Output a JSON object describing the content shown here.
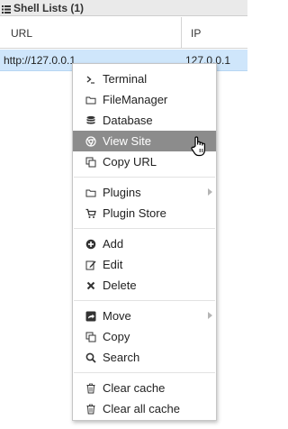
{
  "panel": {
    "title": "Shell Lists (1)",
    "icon": "list-icon"
  },
  "grid": {
    "columns": [
      "URL",
      "IP"
    ],
    "rows": [
      {
        "url": "http://127.0.0.1",
        "ip": "127.0.0.1"
      }
    ],
    "row_highlight_color": "#cfe6fb"
  },
  "context_menu": {
    "active_color": "#8c8c8c",
    "groups": [
      [
        {
          "label": "Terminal",
          "icon": "terminal-icon"
        },
        {
          "label": "FileManager",
          "icon": "folder-icon"
        },
        {
          "label": "Database",
          "icon": "database-icon"
        },
        {
          "label": "View Site",
          "icon": "chrome-icon",
          "active": true
        },
        {
          "label": "Copy URL",
          "icon": "copy-icon"
        }
      ],
      [
        {
          "label": "Plugins",
          "icon": "folder-icon",
          "submenu": true
        },
        {
          "label": "Plugin Store",
          "icon": "cart-icon"
        }
      ],
      [
        {
          "label": "Add",
          "icon": "plus-circle-icon"
        },
        {
          "label": "Edit",
          "icon": "edit-icon"
        },
        {
          "label": "Delete",
          "icon": "x-icon"
        }
      ],
      [
        {
          "label": "Move",
          "icon": "share-icon",
          "submenu": true
        },
        {
          "label": "Copy",
          "icon": "copy-icon"
        },
        {
          "label": "Search",
          "icon": "search-icon"
        }
      ],
      [
        {
          "label": "Clear cache",
          "icon": "trash-icon"
        },
        {
          "label": "Clear all cache",
          "icon": "trash-icon"
        }
      ]
    ]
  }
}
